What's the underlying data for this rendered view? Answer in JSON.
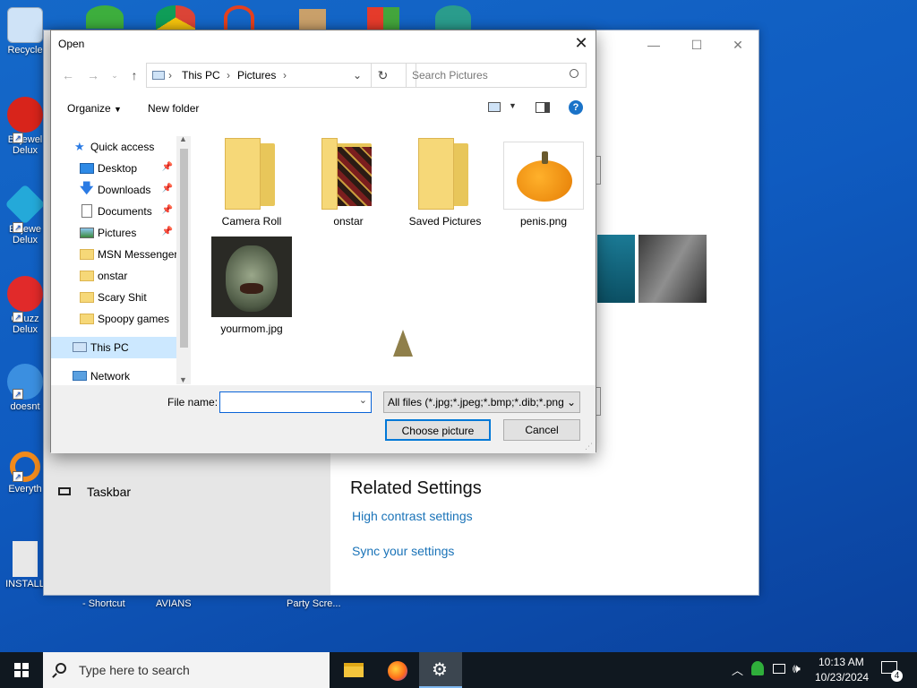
{
  "desktop": {
    "icons": [
      {
        "label": "Recycle",
        "icon": "recycle-bin-icon",
        "color": "#cfe3f7"
      },
      {
        "label": "Bejewel Delux",
        "icon": "bejeweled-2-icon",
        "color": "#d8241b"
      },
      {
        "label": "Bejewe Delux",
        "icon": "bejeweled-icon",
        "color": "#24a9d9"
      },
      {
        "label": "Chuzz Delux",
        "icon": "chuzzle-icon",
        "color": "#e12a2a"
      },
      {
        "label": "doesnt",
        "icon": "globe-icon",
        "color": "#3b8fe0"
      },
      {
        "label": "Everyth",
        "icon": "magnifier-icon",
        "color": "#f08a1c"
      },
      {
        "label": "INSTALL",
        "icon": "document-icon",
        "color": "#e8e8e8"
      }
    ],
    "bottom_labels": [
      "- Shortcut",
      "AVIANS",
      "Party Scre..."
    ]
  },
  "settings_window": {
    "sidebar_item": "Taskbar",
    "related_title": "Related Settings",
    "links": [
      "High contrast settings",
      "Sync your settings"
    ]
  },
  "dialog": {
    "title": "Open",
    "breadcrumb": [
      "This PC",
      "Pictures"
    ],
    "search_placeholder": "Search Pictures",
    "toolbar": {
      "organize": "Organize",
      "new_folder": "New folder"
    },
    "nav": [
      {
        "label": "Quick access",
        "icon": "star-icon",
        "pinned": false
      },
      {
        "label": "Desktop",
        "icon": "desktop-icon",
        "pinned": true
      },
      {
        "label": "Downloads",
        "icon": "download-arrow-icon",
        "pinned": true
      },
      {
        "label": "Documents",
        "icon": "documents-icon",
        "pinned": true
      },
      {
        "label": "Pictures",
        "icon": "pictures-icon",
        "pinned": true
      },
      {
        "label": "MSN Messenger",
        "icon": "folder-icon",
        "pinned": false
      },
      {
        "label": "onstar",
        "icon": "folder-icon",
        "pinned": false
      },
      {
        "label": "Scary Shit",
        "icon": "folder-icon",
        "pinned": false
      },
      {
        "label": "Spoopy games",
        "icon": "folder-icon",
        "pinned": false
      },
      {
        "label": "This PC",
        "icon": "computer-icon",
        "pinned": false,
        "selected": true
      },
      {
        "label": "Network",
        "icon": "network-icon",
        "pinned": false
      }
    ],
    "files": [
      {
        "name": "Camera Roll",
        "kind": "folder"
      },
      {
        "name": "onstar",
        "kind": "folder-with-image"
      },
      {
        "name": "Saved Pictures",
        "kind": "folder"
      },
      {
        "name": "penis.png",
        "kind": "image-pumpkin"
      },
      {
        "name": "yourmom.jpg",
        "kind": "image-face"
      }
    ],
    "file_name_label": "File name:",
    "file_name_value": "",
    "filter": "All files (*.jpg;*.jpeg;*.bmp;*.dib;*.png",
    "choose_button": "Choose picture",
    "cancel_button": "Cancel"
  },
  "taskbar": {
    "search_placeholder": "Type here to search",
    "time": "10:13 AM",
    "date": "10/23/2024",
    "notifications_count": "4"
  }
}
